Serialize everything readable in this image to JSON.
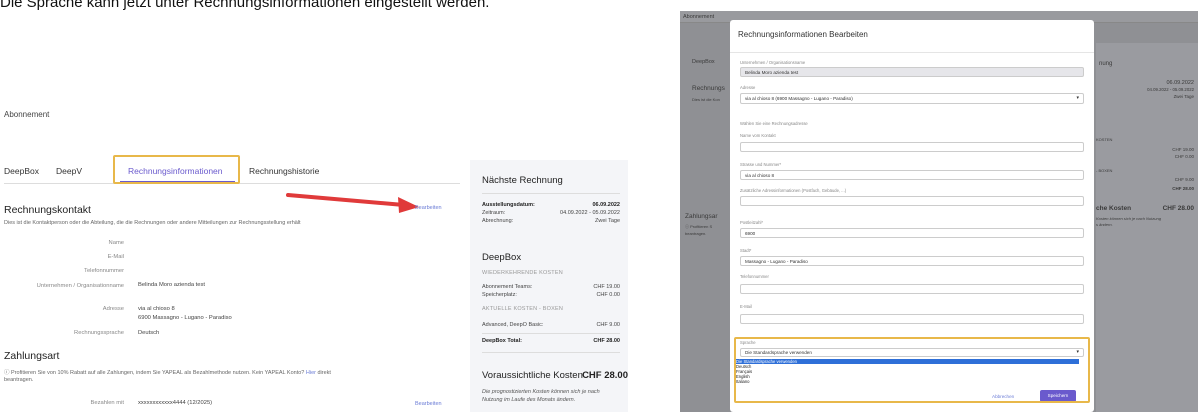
{
  "caption": "Die Sprache kann jetzt unter Rechnungsinformationen eingestellt werden.",
  "left": {
    "title": "Abonnement",
    "tabs": [
      "DeepBox",
      "DeepV",
      "Rechnungsinformationen",
      "Rechnungshistorie"
    ],
    "kontakt": {
      "title": "Rechnungskontakt",
      "edit": "Bearbeiten",
      "desc": "Dies ist die Kontaktperson oder die Abteilung, die die Rechnungen oder andere Mitteilungen zur Rechnungsstellung erhält",
      "fields": [
        {
          "label": "Name",
          "value": ""
        },
        {
          "label": "E-Mail",
          "value": ""
        },
        {
          "label": "Telefonnummer",
          "value": ""
        },
        {
          "label": "Unternehmen / Organisationname",
          "value": "Belinda Moro azienda test"
        },
        {
          "label": "Adresse",
          "value": "via al chioso 8",
          "value2": "6900 Massagno - Lugano - Paradiso"
        },
        {
          "label": "Rechnungssprache",
          "value": "Deutsch"
        }
      ]
    },
    "zahlung": {
      "title": "Zahlungsart",
      "desc": "ⓘ Profitieren Sie von 10% Rabatt auf alle Zahlungen, indem Sie YAPEAL als Bezahlmethode nutzen. Kein YAPEAL Konto?",
      "link": "Hier",
      "desc2": "direkt",
      "desc3": "beantragen.",
      "pay_label": "Bezahlen mit",
      "pay_value": "xxxxxxxxxxxx4444 (12/2025)",
      "edit": "Bearbeiten"
    }
  },
  "card": {
    "title": "Nächste Rechnung",
    "rows": [
      {
        "l": "Ausstellungsdatum:",
        "r": "06.09.2022"
      },
      {
        "l": "Zeitraum:",
        "r": "04.09.2022 - 05.09.2022"
      },
      {
        "l": "Abrechnung:",
        "r": "Zwei Tage"
      }
    ],
    "deepbox": "DeepBox",
    "cap1": "WIEDERKEHRENDE KOSTEN",
    "rows2": [
      {
        "l": "Abonnement Teams:",
        "r": "CHF 19.00"
      },
      {
        "l": "Speicherplatz:",
        "r": "CHF 0.00"
      }
    ],
    "cap2": "AKTUELLE KOSTEN - BOXEN",
    "rows3": [
      {
        "l": "Advanced, DeepO Basic:",
        "r": "CHF 9.00"
      }
    ],
    "total": {
      "l": "DeepBox Total:",
      "r": "CHF 28.00"
    },
    "est_title": "Voraussichtliche Kosten",
    "est_value": "CHF 28.00",
    "est_desc": "Die prognostizierten Kosten können sich je nach Nutzung im Laufe des Monats ändern."
  },
  "right": {
    "bg_title": "Abonnement",
    "bg_deepbox": "DeepBox",
    "bg_rechnung": "Rechnungs",
    "bg_desc": "Dies ist die Kon",
    "bg_zahlung": "Zahlungsar",
    "bg_prof": "ⓘ Profitieren S",
    "bg_beant": "beantragen.",
    "bg_r": [
      "nung",
      "06.09.2022",
      "04.09.2022 - 05.09.2022",
      "Zwei Tage",
      "KOSTEN",
      "CHF 19.00",
      "CHF 0.00",
      "- BOXEN",
      "CHF 9.00",
      "CHF 28.00",
      "che Kosten",
      "CHF 28.00",
      "Kosten können sich je nach Nutzung",
      "s ändern."
    ],
    "modal_title": "Rechnungsinformationen Bearbeiten",
    "fields": [
      {
        "label": "Unternehmen / Organisationsname",
        "value": "Belinda Moro azienda test"
      },
      {
        "label": "Adresse",
        "value": "via al chioso 8 (6900 Massagno - Lugano - Paradiso)"
      },
      {
        "label": "Wählen Sie eine Rechnungsadresse",
        "value": ""
      },
      {
        "label": "Name vom Kontakt",
        "value": ""
      },
      {
        "label": "Strasse und Nummer*",
        "value": "via al chioso 8"
      },
      {
        "label": "Zusätzliche Adressinformationen (Postfach, Gebäude, ...)",
        "value": ""
      },
      {
        "label": "Postleitzahl*",
        "value": "6900"
      },
      {
        "label": "Stadt*",
        "value": "Massagno - Lugano - Paradiso"
      },
      {
        "label": "Telefonnummer",
        "value": ""
      },
      {
        "label": "E-Mail",
        "value": ""
      }
    ],
    "sprache_label": "Sprache",
    "sprache_value": "Die Standardsprache verwenden",
    "options": [
      "Die Standardsprache verwenden",
      "Deutsch",
      "Français",
      "English",
      "Italiano"
    ],
    "cancel": "Abbrechen",
    "save": "Speichern"
  }
}
